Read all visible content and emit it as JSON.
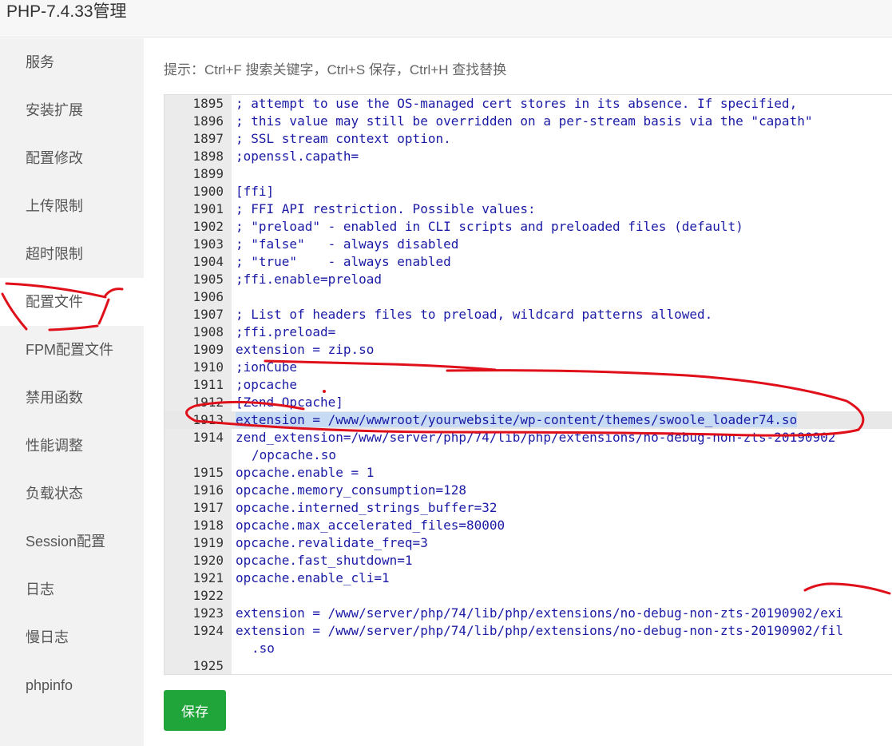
{
  "window": {
    "title": "PHP-7.4.33管理"
  },
  "sidebar": {
    "items": [
      {
        "label": "服务"
      },
      {
        "label": "安装扩展"
      },
      {
        "label": "配置修改"
      },
      {
        "label": "上传限制"
      },
      {
        "label": "超时限制"
      },
      {
        "label": "配置文件",
        "active": true
      },
      {
        "label": "FPM配置文件"
      },
      {
        "label": "禁用函数"
      },
      {
        "label": "性能调整"
      },
      {
        "label": "负载状态"
      },
      {
        "label": "Session配置"
      },
      {
        "label": "日志"
      },
      {
        "label": "慢日志"
      },
      {
        "label": "phpinfo"
      }
    ]
  },
  "hint": "提示：Ctrl+F 搜索关键字，Ctrl+S 保存，Ctrl+H 查找替换",
  "editor": {
    "lines": [
      {
        "num": "1895",
        "code": "; attempt to use the OS-managed cert stores in its absence. If specified,"
      },
      {
        "num": "1896",
        "code": "; this value may still be overridden on a per-stream basis via the \"capath\""
      },
      {
        "num": "1897",
        "code": "; SSL stream context option."
      },
      {
        "num": "1898",
        "code": ";openssl.capath="
      },
      {
        "num": "1899",
        "code": ""
      },
      {
        "num": "1900",
        "code": "[ffi]"
      },
      {
        "num": "1901",
        "code": "; FFI API restriction. Possible values:"
      },
      {
        "num": "1902",
        "code": "; \"preload\" - enabled in CLI scripts and preloaded files (default)"
      },
      {
        "num": "1903",
        "code": "; \"false\"   - always disabled"
      },
      {
        "num": "1904",
        "code": "; \"true\"    - always enabled"
      },
      {
        "num": "1905",
        "code": ";ffi.enable=preload"
      },
      {
        "num": "1906",
        "code": ""
      },
      {
        "num": "1907",
        "code": "; List of headers files to preload, wildcard patterns allowed."
      },
      {
        "num": "1908",
        "code": ";ffi.preload="
      },
      {
        "num": "1909",
        "code": "extension = zip.so"
      },
      {
        "num": "1910",
        "code": ";ionCube"
      },
      {
        "num": "1911",
        "code": ";opcache"
      },
      {
        "num": "1912",
        "code": "[Zend Opcache]"
      },
      {
        "num": "1913",
        "code": "extension = /www/wwwroot/yourwebsite/wp-content/themes/swoole_loader74.so",
        "selected": true
      },
      {
        "num": "1914",
        "code": "zend_extension=/www/server/php/74/lib/php/extensions/no-debug-non-zts-20190902",
        "wrap": "/opcache.so"
      },
      {
        "num": "1915",
        "code": "opcache.enable = 1"
      },
      {
        "num": "1916",
        "code": "opcache.memory_consumption=128"
      },
      {
        "num": "1917",
        "code": "opcache.interned_strings_buffer=32"
      },
      {
        "num": "1918",
        "code": "opcache.max_accelerated_files=80000"
      },
      {
        "num": "1919",
        "code": "opcache.revalidate_freq=3"
      },
      {
        "num": "1920",
        "code": "opcache.fast_shutdown=1"
      },
      {
        "num": "1921",
        "code": "opcache.enable_cli=1"
      },
      {
        "num": "1922",
        "code": ""
      },
      {
        "num": "1923",
        "code": "extension = /www/server/php/74/lib/php/extensions/no-debug-non-zts-20190902/exi"
      },
      {
        "num": "1924",
        "code": "extension = /www/server/php/74/lib/php/extensions/no-debug-non-zts-20190902/fil",
        "wrap": ".so"
      },
      {
        "num": "1925",
        "code": ""
      }
    ]
  },
  "save_button": {
    "label": "保存"
  },
  "colors": {
    "accent_green": "#20a53a",
    "code_text": "#1a1aa6",
    "annotation_red": "#e0101a",
    "selection": "#c7dbf5"
  }
}
